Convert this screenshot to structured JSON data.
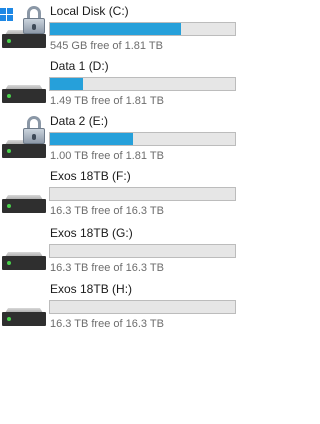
{
  "drives": [
    {
      "name": "Local Disk (C:)",
      "free_text": "545 GB free of 1.81 TB",
      "used_fraction": 0.71,
      "icon": "windows-drive-lock-icon",
      "locked": true,
      "system": true
    },
    {
      "name": "Data 1 (D:)",
      "free_text": "1.49 TB free of 1.81 TB",
      "used_fraction": 0.18,
      "icon": "hard-drive-icon",
      "locked": false,
      "system": false
    },
    {
      "name": "Data 2 (E:)",
      "free_text": "1.00 TB free of 1.81 TB",
      "used_fraction": 0.45,
      "icon": "hard-drive-lock-icon",
      "locked": true,
      "system": false
    },
    {
      "name": "Exos 18TB (F:)",
      "free_text": "16.3 TB free of 16.3 TB",
      "used_fraction": 0.0,
      "icon": "hard-drive-icon",
      "locked": false,
      "system": false
    },
    {
      "name": "Exos 18TB (G:)",
      "free_text": "16.3 TB free of 16.3 TB",
      "used_fraction": 0.0,
      "icon": "hard-drive-icon",
      "locked": false,
      "system": false
    },
    {
      "name": "Exos 18TB (H:)",
      "free_text": "16.3 TB free of 16.3 TB",
      "used_fraction": 0.0,
      "icon": "hard-drive-icon",
      "locked": false,
      "system": false
    }
  ],
  "colors": {
    "bar_fill": "#26a0da",
    "bar_track": "#e6e6e6",
    "bar_border": "#bcbcbc",
    "free_text": "#6d6d6d",
    "led": "#49d14b"
  }
}
